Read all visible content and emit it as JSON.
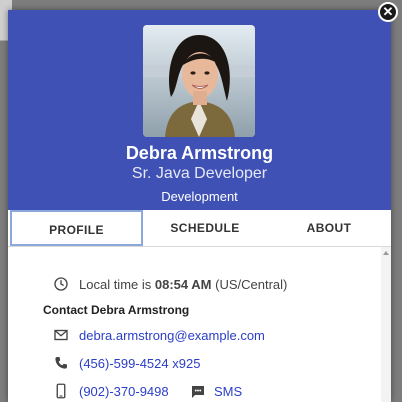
{
  "profile": {
    "name": "Debra Armstrong",
    "title": "Sr. Java Developer",
    "department": "Development"
  },
  "tabs": [
    {
      "label": "PROFILE",
      "active": true
    },
    {
      "label": "SCHEDULE",
      "active": false
    },
    {
      "label": "ABOUT",
      "active": false
    }
  ],
  "local_time": {
    "prefix": "Local time is",
    "time": "08:54 AM",
    "zone": "(US/Central)"
  },
  "contact": {
    "heading": "Contact Debra Armstrong",
    "email": "debra.armstrong@example.com",
    "phone": "(456)-599-4524 x925",
    "mobile": "(902)-370-9498",
    "sms_label": "SMS"
  },
  "close_glyph": "✕",
  "colors": {
    "header_bg": "#3f51b5",
    "link": "#2b3ec7",
    "active_tab_border": "#8aa8da"
  },
  "icons": [
    "clock-icon",
    "envelope-icon",
    "phone-icon",
    "mobile-phone-icon",
    "sms-icon",
    "close-icon"
  ]
}
